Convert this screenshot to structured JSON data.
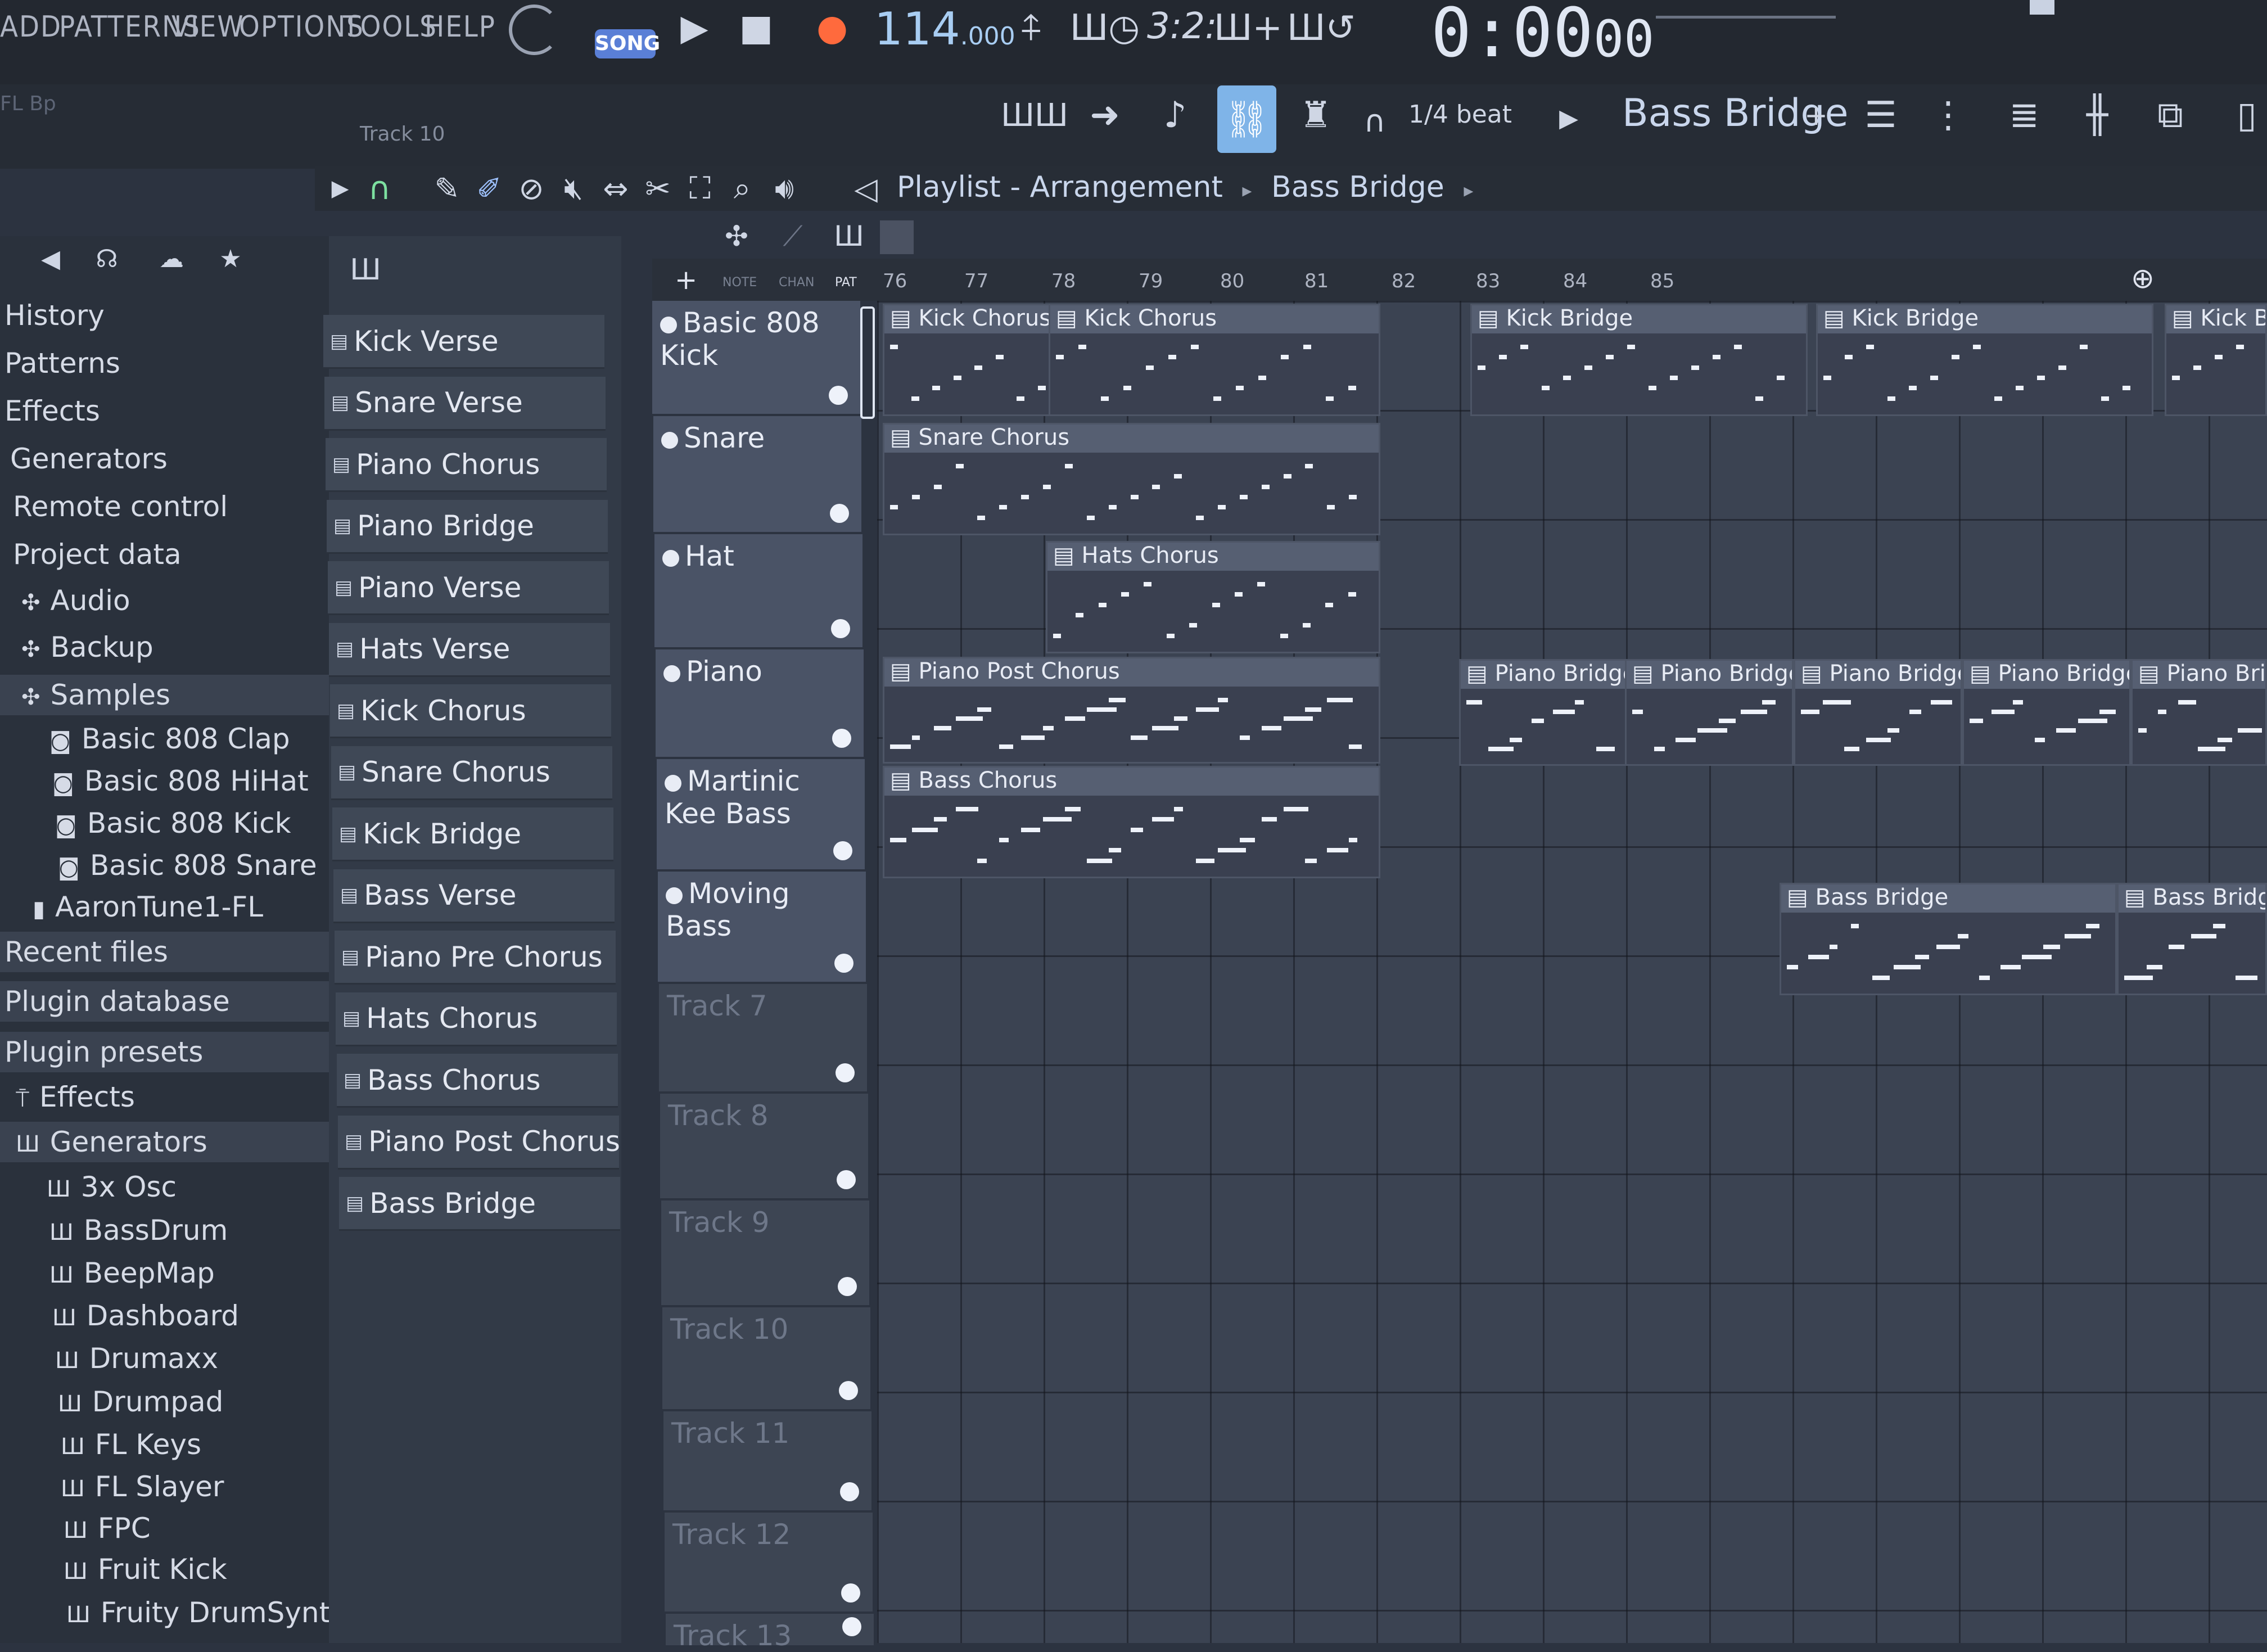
{
  "menu": [
    "ADD",
    "PATTERNS",
    "VIEW",
    "OPTIONS",
    "TOOLS",
    "HELP"
  ],
  "transport": {
    "mode": "SONG",
    "tempo": "114",
    "tempo_frac": ".000",
    "time": "0:00",
    "time_small": "00",
    "step": "3:2:"
  },
  "hint": {
    "track": "Track 10"
  },
  "snap": {
    "label": "1/4 beat"
  },
  "current_pattern": "Bass Bridge",
  "breadcrumb": {
    "root": "Playlist - Arrangement",
    "current": "Bass Bridge"
  },
  "header_mini": {
    "note": "NOTE",
    "chan": "CHAN",
    "pat": "PAT"
  },
  "ruler": [
    "76",
    "77",
    "78",
    "79",
    "80",
    "81",
    "82",
    "83",
    "84",
    "85"
  ],
  "browser": {
    "items": [
      {
        "label": "History"
      },
      {
        "label": "Patterns"
      },
      {
        "label": "Effects"
      },
      {
        "label": "Generators"
      },
      {
        "label": "Remote control"
      },
      {
        "label": "Project data"
      },
      {
        "label": "Audio"
      },
      {
        "label": "Backup"
      },
      {
        "label": "Samples"
      },
      {
        "label": "Basic 808 Clap"
      },
      {
        "label": "Basic 808 HiHat"
      },
      {
        "label": "Basic 808 Kick"
      },
      {
        "label": "Basic 808 Snare"
      },
      {
        "label": "AaronTune1-FL"
      },
      {
        "label": "Recent files"
      },
      {
        "label": "Plugin database"
      },
      {
        "label": "Plugin presets"
      },
      {
        "label": "Effects"
      },
      {
        "label": "Generators"
      },
      {
        "label": "3x Osc"
      },
      {
        "label": "BassDrum"
      },
      {
        "label": "BeepMap"
      },
      {
        "label": "Dashboard"
      },
      {
        "label": "Drumaxx"
      },
      {
        "label": "Drumpad"
      },
      {
        "label": "FL Keys"
      },
      {
        "label": "FL Slayer"
      },
      {
        "label": "FPC"
      },
      {
        "label": "Fruit Kick"
      },
      {
        "label": "Fruity DrumSynth Live"
      }
    ]
  },
  "patterns": [
    "Kick Verse",
    "Snare Verse",
    "Piano Chorus",
    "Piano Bridge",
    "Piano Verse",
    "Hats Verse",
    "Kick Chorus",
    "Snare Chorus",
    "Kick Bridge",
    "Bass Verse",
    "Piano Pre Chorus",
    "Hats Chorus",
    "Bass Chorus",
    "Piano Post Chorus",
    "Bass Bridge"
  ],
  "tracks": [
    "Basic 808 Kick",
    "Snare",
    "Hat",
    "Piano",
    "Martinic Kee Bass",
    "Moving Bass",
    "Track 7",
    "Track 8",
    "Track 9",
    "Track 10",
    "Track 11",
    "Track 12",
    "Track 13"
  ],
  "clips": {
    "kick_chorus_1": "Kick Chorus",
    "kick_chorus_2": "Kick Chorus",
    "kick_bridge_1": "Kick Bridge",
    "kick_bridge_2": "Kick Bridge",
    "kick_bridge_3": "Kick Br",
    "snare_chorus": "Snare Chorus",
    "hats_chorus": "Hats Chorus",
    "piano_post_chorus": "Piano Post Chorus",
    "piano_bridge_1": "Piano Bridge",
    "piano_bridge_2": "Piano Bridge",
    "piano_bridge_3": "Piano Bridge",
    "piano_bridge_4": "Piano Bridge",
    "piano_bridge_5": "Piano Bri",
    "bass_chorus": "Bass Chorus",
    "bass_bridge_1": "Bass Bridge",
    "bass_bridge_2": "Bass Bridge"
  }
}
